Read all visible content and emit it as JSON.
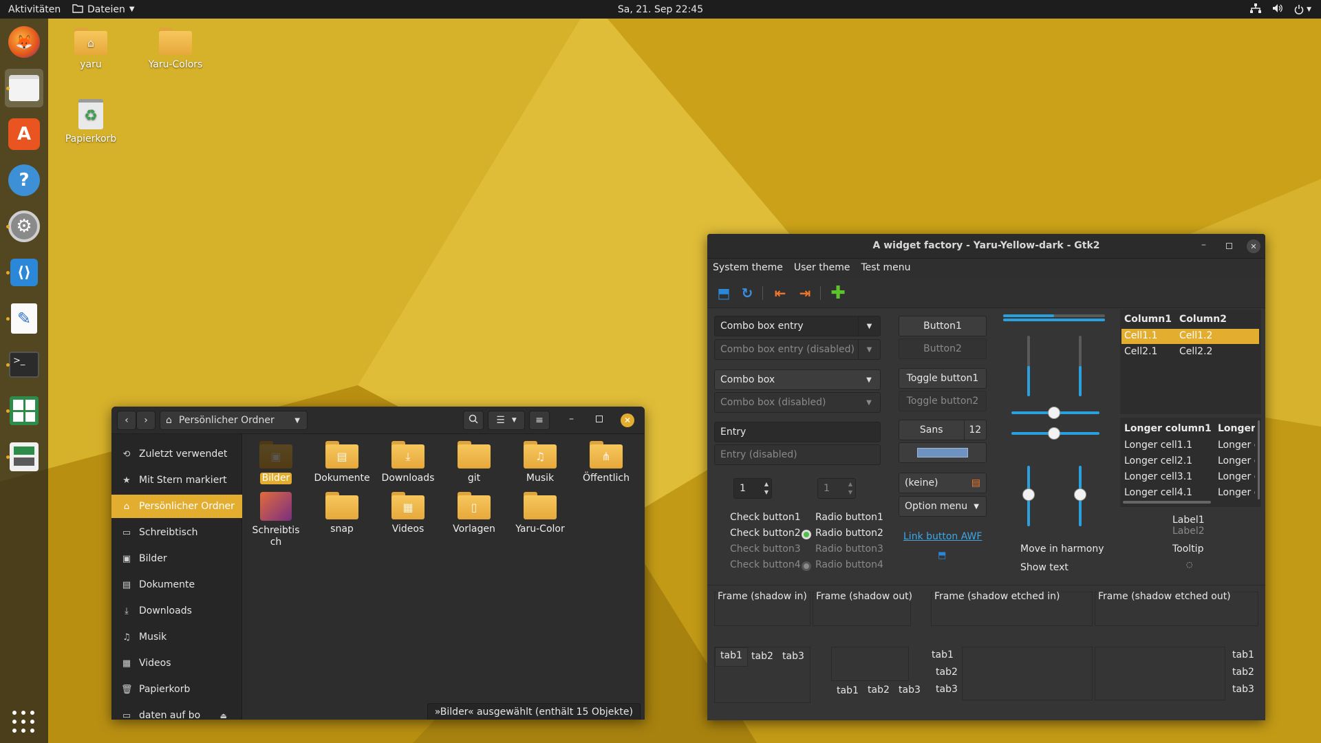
{
  "colors": {
    "accent": "#e3ad2f",
    "panel": "#1d1d1d",
    "window_bg": "#2f2f2f",
    "link": "#3ea7e5",
    "slider": "#2aa1de"
  },
  "topbar": {
    "activities": "Aktivitäten",
    "app_menu": "Dateien",
    "clock": "Sa, 21. Sep  22:45",
    "tray_icons": [
      "network-icon",
      "volume-icon",
      "power-icon"
    ]
  },
  "dock": {
    "items": [
      "firefox-icon",
      "files-icon",
      "software-center-icon",
      "help-icon",
      "settings-icon",
      "vscode-icon",
      "text-editor-icon",
      "terminal-icon",
      "spreadsheet-icon",
      "system-monitor-icon"
    ],
    "show_apps_icon": "app-grid-icon"
  },
  "desktop": {
    "icons": [
      {
        "label": "yaru",
        "icon": "home-folder-icon"
      },
      {
        "label": "Yaru-Colors",
        "icon": "folder-icon"
      },
      {
        "label": "Papierkorb",
        "icon": "trash-icon"
      }
    ]
  },
  "files": {
    "path_label": "Persönlicher Ordner",
    "sidebar": [
      {
        "label": "Zuletzt verwendet",
        "icon": "recent-icon",
        "glyph": "⟲"
      },
      {
        "label": "Mit Stern markiert",
        "icon": "star-icon",
        "glyph": "★"
      },
      {
        "label": "Persönlicher Ordner",
        "icon": "home-icon",
        "glyph": "⌂"
      },
      {
        "label": "Schreibtisch",
        "icon": "desktop-icon",
        "glyph": "▭"
      },
      {
        "label": "Bilder",
        "icon": "pictures-icon",
        "glyph": "▣"
      },
      {
        "label": "Dokumente",
        "icon": "documents-icon",
        "glyph": "▤"
      },
      {
        "label": "Downloads",
        "icon": "downloads-icon",
        "glyph": "⤓"
      },
      {
        "label": "Musik",
        "icon": "music-icon",
        "glyph": "♫"
      },
      {
        "label": "Videos",
        "icon": "videos-icon",
        "glyph": "▦"
      },
      {
        "label": "Papierkorb",
        "icon": "trash-icon",
        "glyph": "🗑"
      },
      {
        "label": "daten auf bo",
        "icon": "network-drive-icon",
        "glyph": "▭"
      }
    ],
    "items": [
      {
        "label": "Bilder",
        "glyph": "▣"
      },
      {
        "label": "Dokumente",
        "glyph": "▤"
      },
      {
        "label": "Downloads",
        "glyph": "⤓"
      },
      {
        "label": "git",
        "glyph": ""
      },
      {
        "label": "Musik",
        "glyph": "♫"
      },
      {
        "label": "Öffentlich",
        "glyph": "⋔"
      },
      {
        "label": "Schreibtisch",
        "glyph": ""
      },
      {
        "label": "snap",
        "glyph": ""
      },
      {
        "label": "Videos",
        "glyph": "▦"
      },
      {
        "label": "Vorlagen",
        "glyph": "▯"
      },
      {
        "label": "Yaru-Color",
        "glyph": ""
      }
    ],
    "status": "»Bilder« ausgewählt  (enthält 15 Objekte)"
  },
  "wf": {
    "title": "A widget factory - Yaru-Yellow-dark - Gtk2",
    "menu": [
      "System theme",
      "User theme",
      "Test menu"
    ],
    "combo_entry": "Combo box entry",
    "combo_entry_disabled": "Combo box entry (disabled)",
    "combo": "Combo box",
    "combo_disabled": "Combo box (disabled)",
    "entry": "Entry",
    "entry_disabled": "Entry (disabled)",
    "spin1": "1",
    "spin2": "1",
    "checks": [
      "Check button1",
      "Check button2",
      "Check button3",
      "Check button4"
    ],
    "radios": [
      "Radio button1",
      "Radio button2",
      "Radio button3",
      "Radio button4"
    ],
    "button1": "Button1",
    "button2": "Button2",
    "toggle1": "Toggle button1",
    "toggle2": "Toggle button2",
    "font_name": "Sans",
    "font_size": "12",
    "file_chooser": "(keine)",
    "option_menu": "Option menu",
    "link": "Link button AWF",
    "harmony": "Move in harmony",
    "show_text": "Show text",
    "tree1": {
      "headers": [
        "Column1",
        "Column2"
      ],
      "rows": [
        [
          "Cell1.1",
          "Cell1.2"
        ],
        [
          "Cell2.1",
          "Cell2.2"
        ]
      ]
    },
    "tree2": {
      "headers": [
        "Longer column1",
        "Longer"
      ],
      "rows": [
        [
          "Longer cell1.1",
          "Longer c"
        ],
        [
          "Longer cell2.1",
          "Longer c"
        ],
        [
          "Longer cell3.1",
          "Longer c"
        ],
        [
          "Longer cell4.1",
          "Longer c"
        ]
      ]
    },
    "label1": "Label1",
    "label2": "Label2",
    "tooltip": "Tooltip",
    "frames": [
      "Frame (shadow in)",
      "Frame (shadow out)",
      "Frame (shadow etched in)",
      "Frame (shadow etched out)"
    ],
    "tabs": [
      "tab1",
      "tab2",
      "tab3"
    ]
  }
}
